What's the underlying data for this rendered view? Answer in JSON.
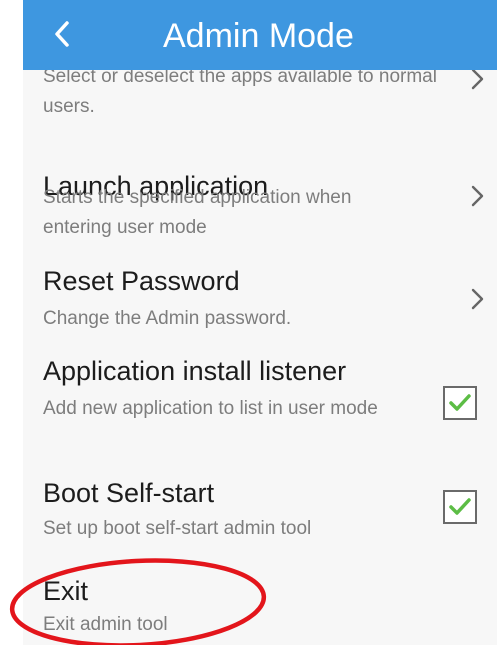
{
  "appbar": {
    "title": "Admin Mode",
    "back_icon": "chevron-left-icon"
  },
  "items": [
    {
      "id": "app-list",
      "title": "",
      "subtitle": "Select or deselect the apps available to normal users.",
      "control": "chevron"
    },
    {
      "id": "launch-application",
      "title": "Launch application",
      "subtitle": "Starts the specified application when entering user mode",
      "control": "chevron"
    },
    {
      "id": "reset-password",
      "title": "Reset Password",
      "subtitle": "Change the Admin password.",
      "control": "chevron"
    },
    {
      "id": "application-install-listener",
      "title": "Application install listener",
      "subtitle": "Add new application to list in user mode",
      "control": "checkbox",
      "checked": true
    },
    {
      "id": "boot-self-start",
      "title": "Boot Self-start",
      "subtitle": "Set up boot self-start admin tool",
      "control": "checkbox",
      "checked": true
    },
    {
      "id": "exit",
      "title": "Exit",
      "subtitle": "Exit admin tool",
      "control": "none"
    }
  ],
  "colors": {
    "appbar": "#3e97e0",
    "checkmark": "#5cbd45",
    "highlight_ring": "#e3151b"
  }
}
